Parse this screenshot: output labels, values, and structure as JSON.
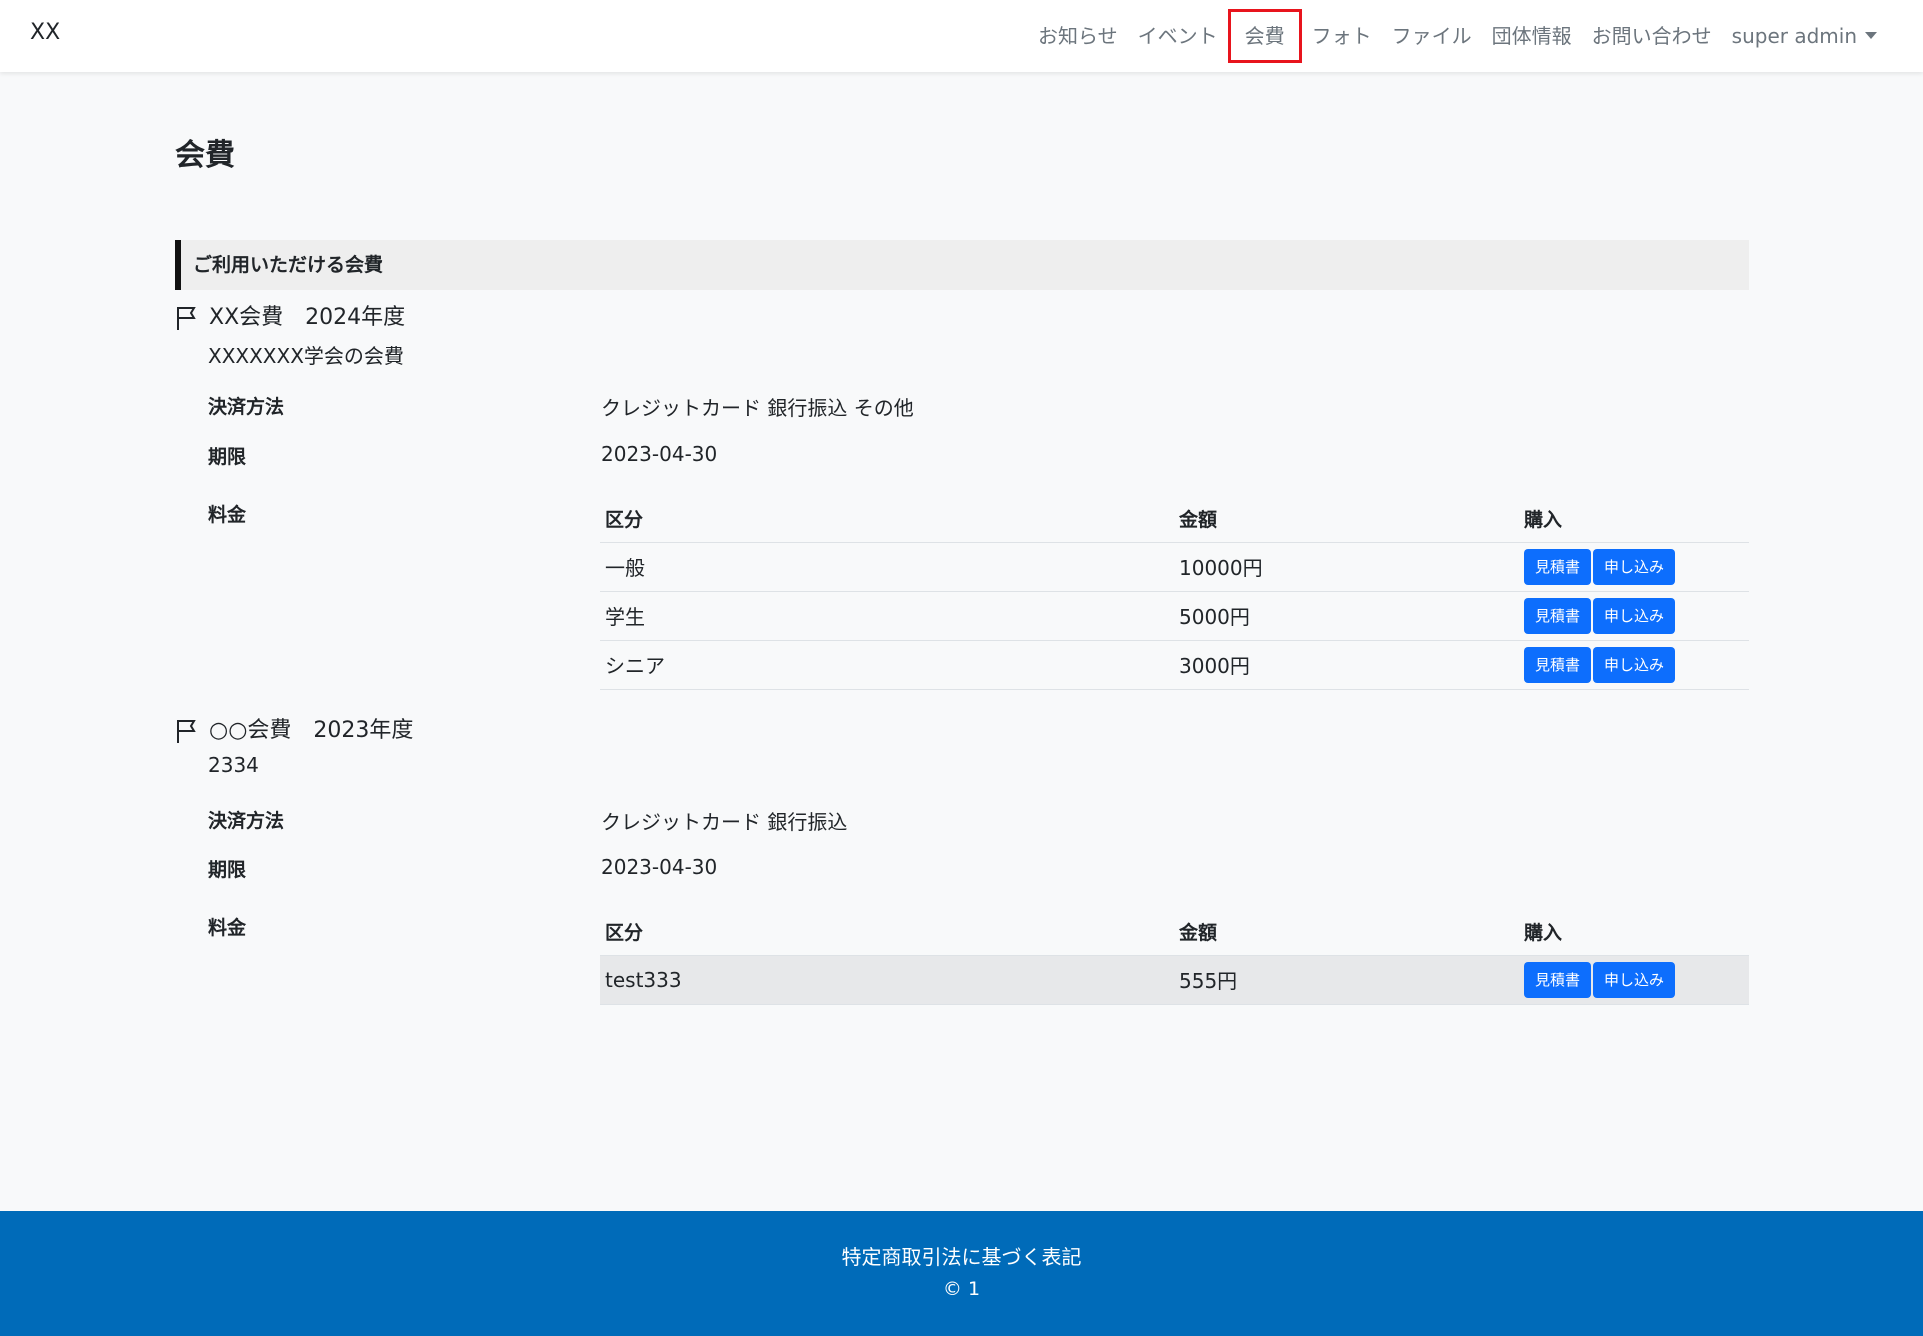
{
  "navbar": {
    "brand": "XX",
    "items": [
      {
        "label": "お知らせ"
      },
      {
        "label": "イベント"
      },
      {
        "label": "会費"
      },
      {
        "label": "フォト"
      },
      {
        "label": "ファイル"
      },
      {
        "label": "団体情報"
      },
      {
        "label": "お問い合わせ"
      }
    ],
    "user": "super admin",
    "active_color": "#e8141d"
  },
  "page": {
    "title": "会費",
    "section_heading": "ご利用いただける会費"
  },
  "labels": {
    "payment": "決済方法",
    "deadline": "期限",
    "price": "料金",
    "col_kubun": "区分",
    "col_amount": "金額",
    "col_purchase": "購入",
    "quote_button": "見積書",
    "apply_button": "申し込み"
  },
  "fees": [
    {
      "title": "XX会費　2024年度",
      "description": "XXXXXXX学会の会費",
      "payment": "クレジットカード 銀行振込 その他",
      "deadline": "2023-04-30",
      "rows": [
        {
          "kubun": "一般",
          "amount": "10000円"
        },
        {
          "kubun": "学生",
          "amount": "5000円"
        },
        {
          "kubun": "シニア",
          "amount": "3000円"
        }
      ]
    },
    {
      "title": "○○会費　2023年度",
      "description": "2334",
      "payment": "クレジットカード 銀行振込",
      "deadline": "2023-04-30",
      "rows": [
        {
          "kubun": "test333",
          "amount": "555円"
        }
      ]
    }
  ],
  "footer": {
    "link": "特定商取引法に基づく表記",
    "copyright": "© 1"
  },
  "colors": {
    "primary_button": "#0d6efd",
    "footer_bg": "#006bb9"
  }
}
